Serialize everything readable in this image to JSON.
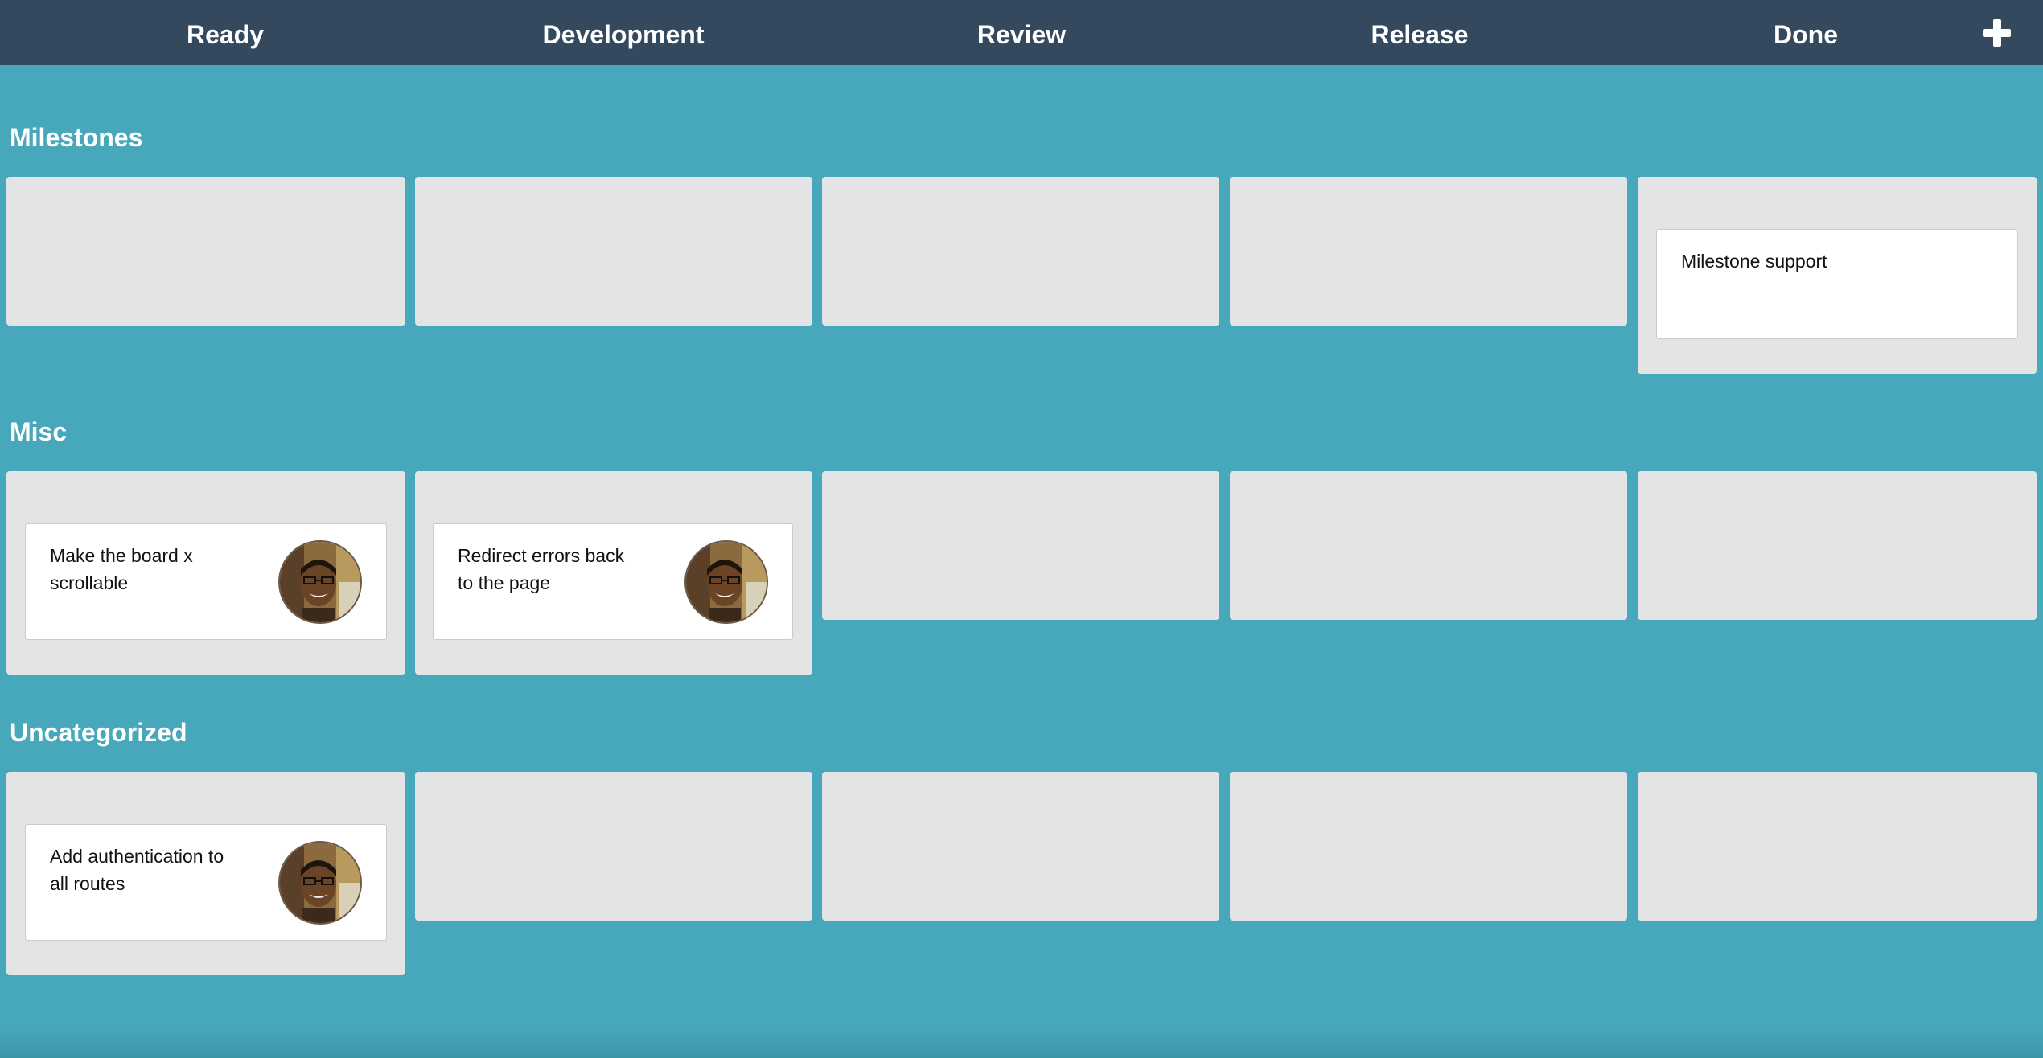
{
  "columns": [
    "Ready",
    "Development",
    "Review",
    "Release",
    "Done"
  ],
  "add_icon": "plus-icon",
  "lanes": [
    {
      "title": "Milestones",
      "cards": [
        {
          "column": "Done",
          "title": "Milestone support",
          "has_avatar": false
        }
      ]
    },
    {
      "title": "Misc",
      "cards": [
        {
          "column": "Ready",
          "title": "Make the board x scrollable",
          "has_avatar": true
        },
        {
          "column": "Development",
          "title": "Redirect errors back to the page",
          "has_avatar": true
        }
      ]
    },
    {
      "title": "Uncategorized",
      "cards": [
        {
          "column": "Ready",
          "title": "Add authentication to all routes",
          "has_avatar": true
        }
      ]
    }
  ],
  "colors": {
    "topbar": "#34495e",
    "board_background": "#47a8bb",
    "cell_background": "#e3e4e6",
    "card_background": "#ffffff",
    "header_text": "#ffffff"
  }
}
